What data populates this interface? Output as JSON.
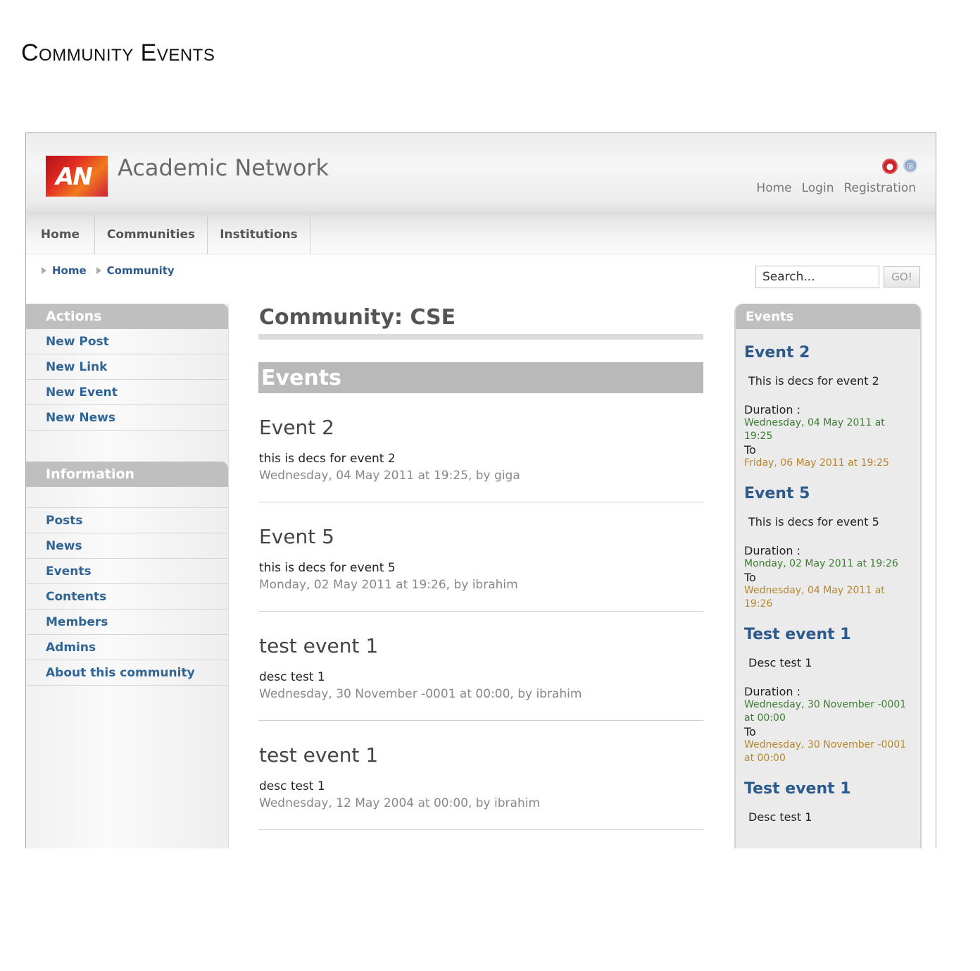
{
  "doc_title": "Community Events",
  "header": {
    "site_name": "Academic Network",
    "logo_text": "AN",
    "icons": [
      "flag-icon",
      "globe-icon"
    ],
    "links": [
      "Home",
      "Login",
      "Registration"
    ]
  },
  "nav": {
    "items": [
      "Home",
      "Communities",
      "Institutions"
    ]
  },
  "breadcrumb": {
    "items": [
      "Home",
      "Community"
    ]
  },
  "search": {
    "placeholder": "Search...",
    "button": "GO!"
  },
  "left_sidebar": {
    "actions_title": "Actions",
    "actions": [
      "New Post",
      "New Link",
      "New Event",
      "New News"
    ],
    "information_title": "Information",
    "information": [
      "Posts",
      "News",
      "Events",
      "Contents",
      "Members",
      "Admins",
      "About this community"
    ]
  },
  "main": {
    "title": "Community: CSE",
    "section_title": "Events",
    "events": [
      {
        "title": "Event 2",
        "desc": "this is decs for event 2",
        "meta": "Wednesday, 04 May 2011 at 19:25, by giga"
      },
      {
        "title": "Event 5",
        "desc": "this is decs for event 5",
        "meta": "Monday, 02 May 2011 at 19:26, by ibrahim"
      },
      {
        "title": "test event 1",
        "desc": "desc test 1",
        "meta": "Wednesday, 30 November -0001 at 00:00, by ibrahim"
      },
      {
        "title": "test event 1",
        "desc": "desc test 1",
        "meta": "Wednesday, 12 May 2004 at 00:00, by ibrahim"
      }
    ]
  },
  "right_sidebar": {
    "title": "Events",
    "duration_label": "Duration :",
    "to_label": "To",
    "events": [
      {
        "title": "Event 2",
        "desc": "This is decs for event 2",
        "start": "Wednesday, 04 May 2011 at 19:25",
        "end": "Friday, 06 May 2011 at 19:25"
      },
      {
        "title": "Event 5",
        "desc": "This is decs for event 5",
        "start": "Monday, 02 May 2011 at 19:26",
        "end": "Wednesday, 04 May 2011 at 19:26"
      },
      {
        "title": "Test event 1",
        "desc": "Desc test 1",
        "start": "Wednesday, 30 November -0001 at 00:00",
        "end": "Wednesday, 30 November -0001 at 00:00"
      },
      {
        "title": "Test event 1",
        "desc": "Desc test 1"
      }
    ]
  },
  "colors": {
    "link_blue": "#2f6496",
    "start_green": "#3b7d2f",
    "end_orange": "#b8862a",
    "header_gray": "#bfbfbf"
  }
}
